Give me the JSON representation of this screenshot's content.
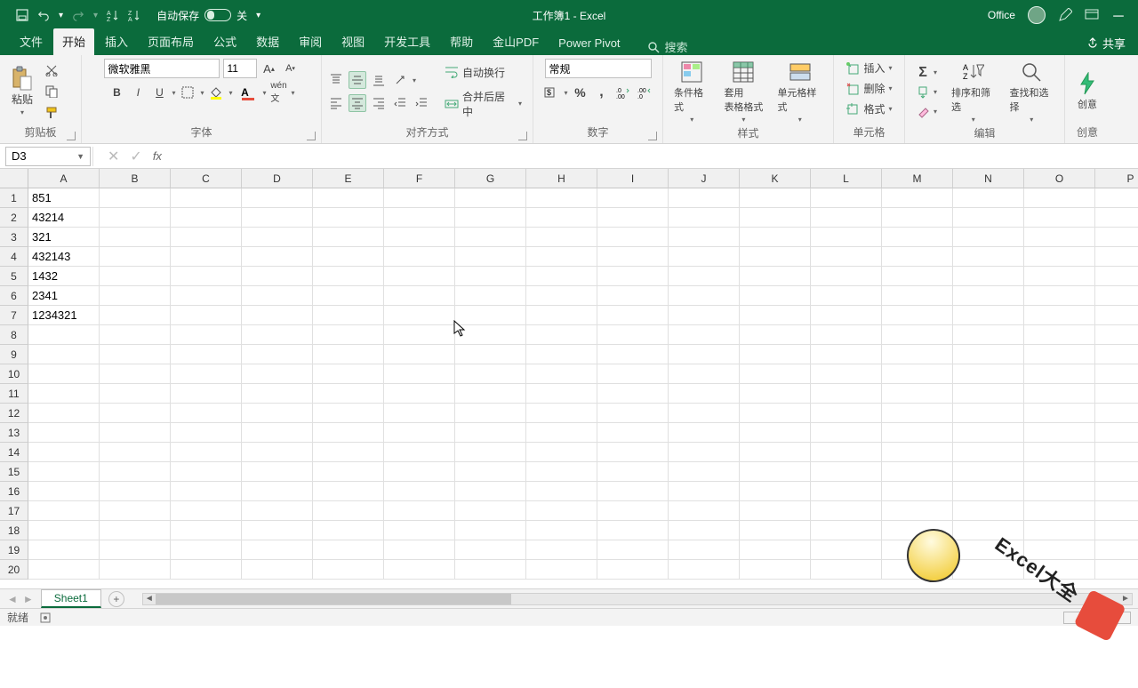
{
  "titlebar": {
    "autosave_label": "自动保存",
    "autosave_off": "关",
    "doc_title": "工作簿1  -  Excel",
    "office_label": "Office"
  },
  "tabs": {
    "file": "文件",
    "home": "开始",
    "insert": "插入",
    "layout": "页面布局",
    "formulas": "公式",
    "data": "数据",
    "review": "审阅",
    "view": "视图",
    "dev": "开发工具",
    "help": "帮助",
    "pdf": "金山PDF",
    "powerpivot": "Power Pivot",
    "search_placeholder": "搜索",
    "share": "共享"
  },
  "ribbon": {
    "clipboard": {
      "paste": "粘贴",
      "label": "剪贴板"
    },
    "font": {
      "name": "微软雅黑",
      "size": "11",
      "label": "字体"
    },
    "align": {
      "wrap": "自动换行",
      "merge": "合并后居中",
      "label": "对齐方式"
    },
    "number": {
      "format": "常规",
      "label": "数字"
    },
    "styles": {
      "cond": "条件格式",
      "table": "套用\n表格格式",
      "cell": "单元格样式",
      "label": "样式"
    },
    "cells": {
      "insert": "插入",
      "delete": "删除",
      "format": "格式",
      "label": "单元格"
    },
    "editing": {
      "sort": "排序和筛选",
      "find": "查找和选择",
      "label": "编辑"
    },
    "ideas": {
      "label": "创意"
    }
  },
  "namebox": "D3",
  "columns": [
    "A",
    "B",
    "C",
    "D",
    "E",
    "F",
    "G",
    "H",
    "I",
    "J",
    "K",
    "L",
    "M",
    "N",
    "O",
    "P"
  ],
  "rows": [
    1,
    2,
    3,
    4,
    5,
    6,
    7,
    8,
    9,
    10,
    11,
    12,
    13,
    14,
    15,
    16,
    17,
    18,
    19,
    20
  ],
  "cells": {
    "A1": "851",
    "A2": "43214",
    "A3": "321",
    "A4": "432143",
    "A5": "1432",
    "A6": "2341",
    "A7": "1234321"
  },
  "sheet_tab": "Sheet1",
  "statusbar": {
    "ready": "就绪"
  },
  "watermark": "Excel大全"
}
